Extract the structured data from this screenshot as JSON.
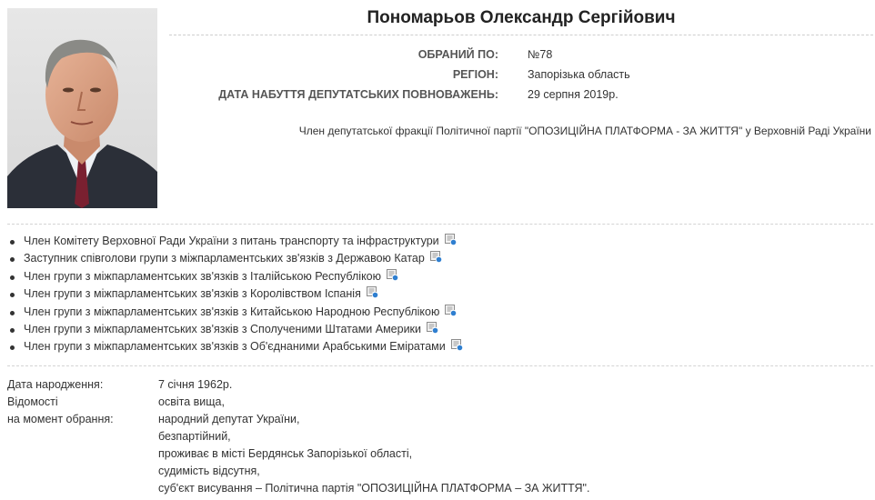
{
  "deputy": {
    "full_name": "Пономарьов Олександр Сергійович",
    "photo_alt": "portrait-photo"
  },
  "election": {
    "elected_by_label": "ОБРАНИЙ ПО:",
    "elected_by_value": "№78",
    "region_label": "РЕГІОН:",
    "region_value": "Запорізька область",
    "mandate_date_label": "ДАТА НАБУТТЯ ДЕПУТАТСЬКИХ ПОВНОВАЖЕНЬ:",
    "mandate_date_value": "29 серпня 2019р."
  },
  "faction_text": "Член депутатської фракції Політичної партії \"ОПОЗИЦІЙНА ПЛАТФОРМА - ЗА ЖИТТЯ\" у Верховній Раді України",
  "roles": [
    {
      "label": "Член Комітету Верховної Ради України з питань транспорту та інфраструктури",
      "icon": "document-link-icon"
    },
    {
      "label": "Заступник співголови групи з міжпарламентських зв'язків з Державою Катар",
      "icon": "document-link-icon"
    },
    {
      "label": "Член групи з міжпарламентських зв'язків з Італійською Республікою",
      "icon": "document-link-icon"
    },
    {
      "label": "Член групи з міжпарламентських зв'язків з Королівством Іспанія",
      "icon": "document-link-icon"
    },
    {
      "label": "Член групи з міжпарламентських зв'язків з Китайською Народною Республікою",
      "icon": "document-link-icon"
    },
    {
      "label": "Член групи з міжпарламентських зв'язків з Сполученими Штатами Америки",
      "icon": "document-link-icon"
    },
    {
      "label": "Член групи з міжпарламентських зв'язків з Об'єднаними Арабськими Еміратами",
      "icon": "document-link-icon"
    }
  ],
  "bio": {
    "birth_label": "Дата народження:",
    "birth_value": "7 січня 1962р.",
    "info_label_1": "Відомості",
    "info_label_2": "на момент обрання:",
    "info_lines": [
      "освіта вища,",
      "народний депутат України,",
      "безпартійний,",
      "проживає в місті Бердянськ Запорізької області,",
      "судимість відсутня,",
      "суб'єкт висування – Політична партія \"ОПОЗИЦІЙНА ПЛАТФОРМА – ЗА ЖИТТЯ\"."
    ]
  },
  "colors": {
    "text": "#333333",
    "label": "#555555",
    "divider": "#d3d3d3"
  }
}
